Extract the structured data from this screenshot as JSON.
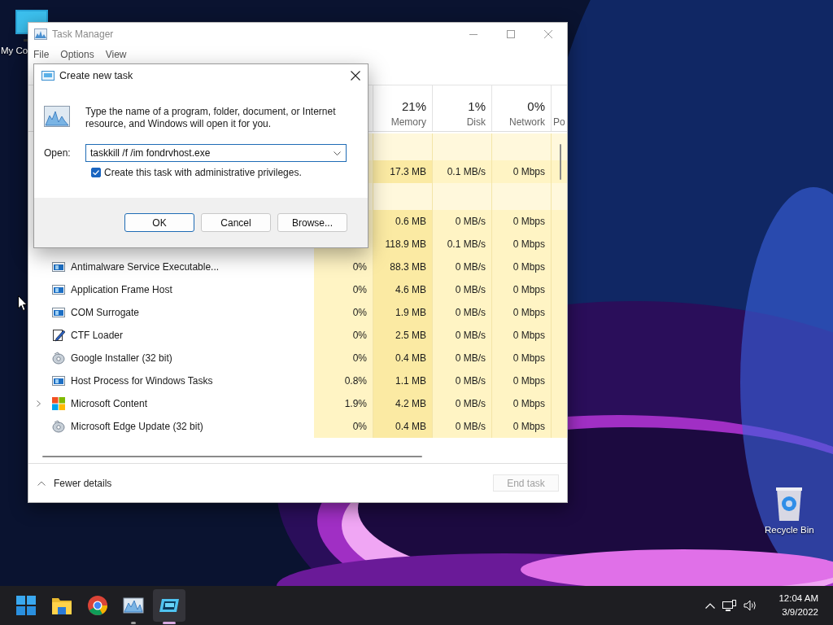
{
  "desktop_icons": [
    {
      "label": "My Co"
    },
    {
      "label": "Recycle Bin"
    }
  ],
  "task_manager": {
    "title": "Task Manager",
    "menu": [
      "File",
      "Options",
      "View"
    ],
    "columns": [
      {
        "percent": "21%",
        "label": "Memory"
      },
      {
        "percent": "1%",
        "label": "Disk"
      },
      {
        "percent": "0%",
        "label": "Network"
      },
      {
        "label": "Po"
      }
    ],
    "rows": [
      {
        "kind": "group"
      },
      {
        "kind": "process",
        "memory": "17.3 MB",
        "disk": "0.1 MB/s",
        "network": "0 Mbps"
      },
      {
        "kind": "group"
      },
      {
        "kind": "process",
        "memory": "0.6 MB",
        "disk": "0 MB/s",
        "network": "0 Mbps"
      },
      {
        "kind": "process",
        "memory": "118.9 MB",
        "disk": "0.1 MB/s",
        "network": "0 Mbps"
      },
      {
        "kind": "window",
        "has_children": false,
        "name": "Antimalware Service Executable...",
        "cpu": "0%",
        "memory": "88.3 MB",
        "disk": "0 MB/s",
        "network": "0 Mbps"
      },
      {
        "kind": "window",
        "has_children": false,
        "name": "Application Frame Host",
        "cpu": "0%",
        "memory": "4.6 MB",
        "disk": "0 MB/s",
        "network": "0 Mbps"
      },
      {
        "kind": "window",
        "has_children": false,
        "name": "COM Surrogate",
        "cpu": "0%",
        "memory": "1.9 MB",
        "disk": "0 MB/s",
        "network": "0 Mbps"
      },
      {
        "kind": "pen",
        "has_children": false,
        "name": "CTF Loader",
        "cpu": "0%",
        "memory": "2.5 MB",
        "disk": "0 MB/s",
        "network": "0 Mbps"
      },
      {
        "kind": "installer",
        "has_children": false,
        "name": "Google Installer (32 bit)",
        "cpu": "0%",
        "memory": "0.4 MB",
        "disk": "0 MB/s",
        "network": "0 Mbps"
      },
      {
        "kind": "window",
        "has_children": false,
        "name": "Host Process for Windows Tasks",
        "cpu": "0.8%",
        "memory": "1.1 MB",
        "disk": "0 MB/s",
        "network": "0 Mbps"
      },
      {
        "kind": "tiles",
        "has_children": true,
        "name": "Microsoft Content",
        "cpu": "1.9%",
        "memory": "4.2 MB",
        "disk": "0 MB/s",
        "network": "0 Mbps"
      },
      {
        "kind": "installer",
        "has_children": false,
        "name": "Microsoft Edge Update (32 bit)",
        "cpu": "0%",
        "memory": "0.4 MB",
        "disk": "0 MB/s",
        "network": "0 Mbps"
      }
    ],
    "footer": {
      "toggle": "Fewer details",
      "end_task": {
        "label": "End task",
        "disabled": true
      }
    }
  },
  "dialog": {
    "title": "Create new task",
    "message": "Type the name of a program, folder, document, or Internet resource, and Windows will open it for you.",
    "open_label": "Open:",
    "open_value": "taskkill /f /im fondrvhost.exe",
    "admin_checkbox": {
      "label": "Create this task with administrative privileges.",
      "checked": true
    },
    "buttons": [
      {
        "label": "OK",
        "default": true
      },
      {
        "label": "Cancel",
        "default": false
      },
      {
        "label": "Browse...",
        "default": false
      }
    ]
  },
  "taskbar": {
    "apps": [
      {
        "kind": "start",
        "running": false,
        "active": false
      },
      {
        "kind": "folder",
        "running": false,
        "active": false
      },
      {
        "kind": "browser",
        "running": false,
        "active": false
      },
      {
        "kind": "chart",
        "running": true,
        "active": false
      },
      {
        "kind": "run",
        "running": true,
        "active": true
      }
    ],
    "clock": {
      "time": "12:04 AM",
      "date": "3/9/2022"
    }
  }
}
